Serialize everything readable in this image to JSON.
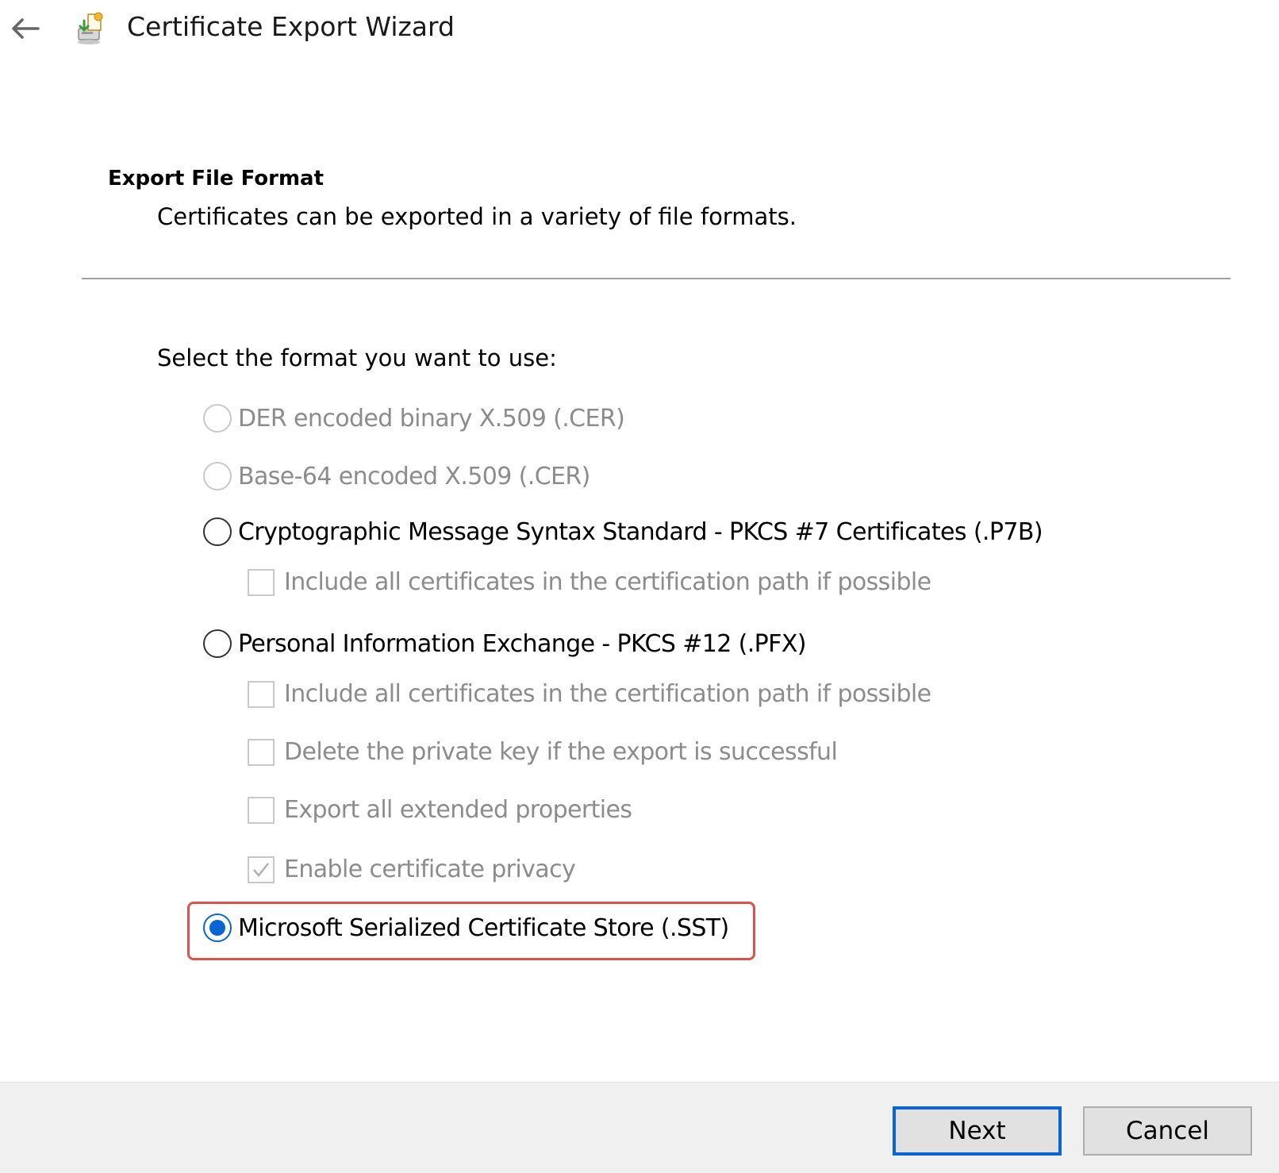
{
  "window": {
    "title": "Certificate Export Wizard",
    "back_icon": "arrow-left-icon",
    "wizard_icon": "certificate-export-icon"
  },
  "header": {
    "title": "Export File Format",
    "subtitle": "Certificates can be exported in a variety of file formats."
  },
  "prompt": "Select the format you want to use:",
  "options": [
    {
      "label": "DER encoded binary X.509 (.CER)",
      "selected": false,
      "enabled": false
    },
    {
      "label": "Base-64 encoded X.509 (.CER)",
      "selected": false,
      "enabled": false
    },
    {
      "label": "Cryptographic Message Syntax Standard - PKCS #7 Certificates (.P7B)",
      "selected": false,
      "enabled": true
    },
    {
      "label": "Personal Information Exchange - PKCS #12 (.PFX)",
      "selected": false,
      "enabled": true
    },
    {
      "label": "Microsoft Serialized Certificate Store (.SST)",
      "selected": true,
      "enabled": true
    }
  ],
  "p7b_options": [
    {
      "label": "Include all certificates in the certification path if possible",
      "checked": false,
      "enabled": false
    }
  ],
  "pfx_options": [
    {
      "label": "Include all certificates in the certification path if possible",
      "checked": false,
      "enabled": false
    },
    {
      "label": "Delete the private key if the export is successful",
      "checked": false,
      "enabled": false
    },
    {
      "label": "Export all extended properties",
      "checked": false,
      "enabled": false
    },
    {
      "label": "Enable certificate privacy",
      "checked": true,
      "enabled": false
    }
  ],
  "footer": {
    "next_label": "Next",
    "cancel_label": "Cancel"
  },
  "colors": {
    "accent": "#0a64d2",
    "highlight": "#d9534f",
    "disabled_text": "#8c8c8c"
  }
}
